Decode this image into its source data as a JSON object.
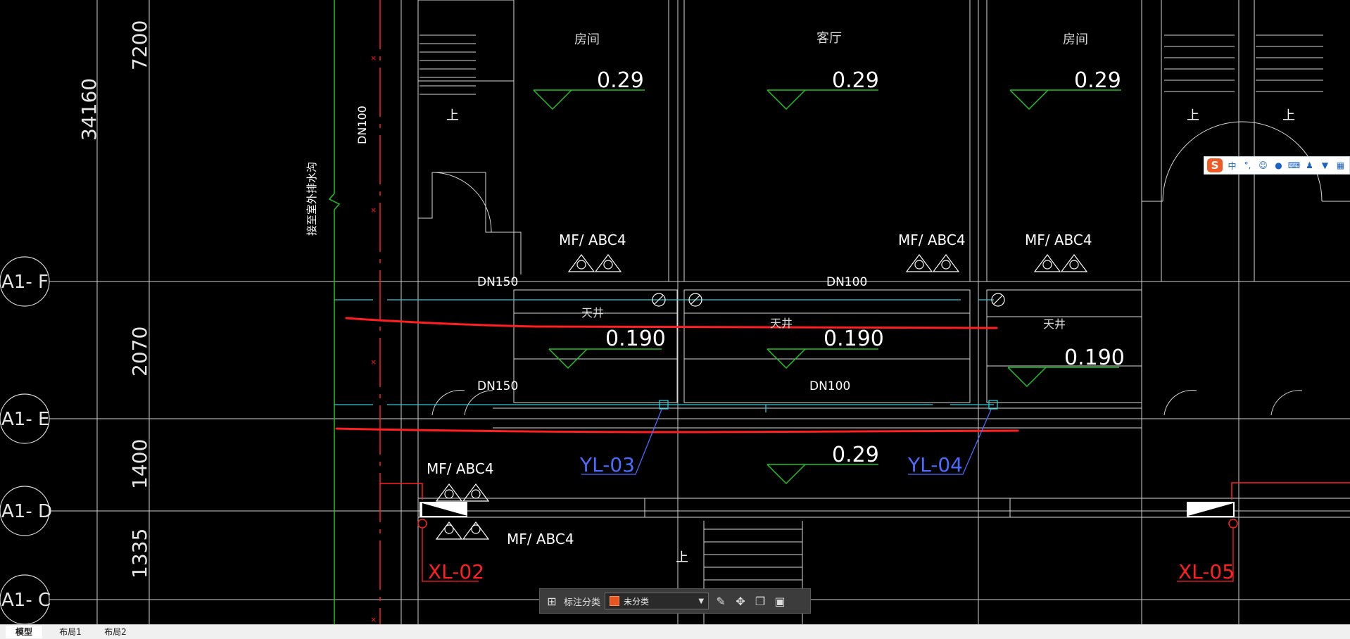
{
  "drawing": {
    "grid_axes": [
      {
        "label": "A1- F"
      },
      {
        "label": "A1- E"
      },
      {
        "label": "A1- D"
      },
      {
        "label": "A1- C"
      }
    ],
    "dimensions": {
      "total": "34160",
      "segments": [
        "7200",
        "2070",
        "1400",
        "1335"
      ]
    },
    "rooms": {
      "room_left": "房间",
      "living": "客厅",
      "room_right": "房间"
    },
    "shafts": [
      "天井",
      "天井",
      "天井"
    ],
    "elevations": {
      "floor": "0.29",
      "shaft": "0.190"
    },
    "pipes": {
      "dn150": "DN150",
      "dn100": "DN100",
      "vertical_label": "DN100",
      "drain_note": "接至室外排水沟"
    },
    "extinguishers": {
      "label": "MF/ ABC4"
    },
    "risers": {
      "yl_03": "YL-03",
      "yl_04": "YL-04",
      "xl_02": "XL-02",
      "xl_05": "XL-05"
    },
    "stairs": {
      "up": "上"
    },
    "colors": {
      "grid": "#cfcfcf",
      "green": "#22c322",
      "cyan": "#2ec9d6",
      "red": "#ff1f1f",
      "blue": "#4a6cff",
      "white": "#ffffff"
    }
  },
  "annotation_toolbar": {
    "label": "标注分类",
    "selected": "未分类",
    "swatch_color": "#e8561f"
  },
  "layout_tabs": {
    "model": "模型",
    "layout1": "布局1",
    "layout2": "布局2"
  },
  "ime": {
    "mode": "中",
    "punct": "°,"
  }
}
